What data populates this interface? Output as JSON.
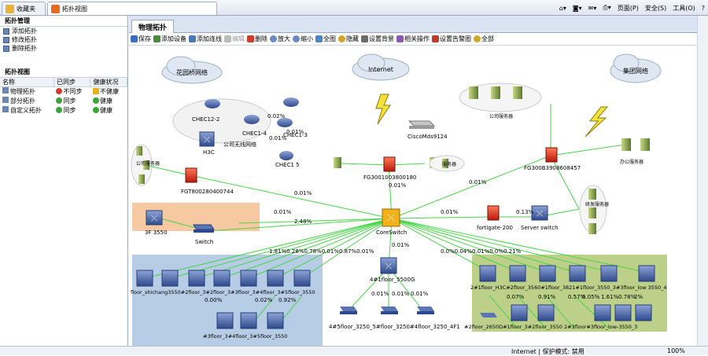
{
  "browser": {
    "tabs": [
      {
        "label": "收藏夹"
      },
      {
        "label": "拓扑视图"
      }
    ],
    "tools": {
      "page": "页面(P)",
      "safety": "安全(S)",
      "tools": "工具(O)",
      "help": "?"
    }
  },
  "left": {
    "manage_title": "拓扑管理",
    "manage_items": [
      {
        "label": "添加拓扑"
      },
      {
        "label": "修改拓扑"
      },
      {
        "label": "删除拓扑"
      }
    ],
    "view_title": "拓扑视图",
    "table_headers": [
      "名称",
      "已同步",
      "健康状况"
    ],
    "rows": [
      {
        "name": "物理拓扑",
        "sync": "不同步",
        "health": "不健康"
      },
      {
        "name": "部分拓扑",
        "sync": "同步",
        "health": "健康"
      },
      {
        "name": "自定义拓扑",
        "sync": "同步",
        "health": "健康"
      }
    ]
  },
  "main": {
    "tab": "物理拓扑",
    "toolbar": [
      "保存",
      "添加设备",
      "添加连线",
      "编辑",
      "删除",
      "放大",
      "缩小",
      "全图",
      "隐藏",
      "设置背景",
      "相关操作",
      "设置告警图",
      "全部"
    ]
  },
  "topology": {
    "clouds": {
      "garden": "花园桥网络",
      "internet": "Internet",
      "group": "集团网络"
    },
    "labels": {
      "core": "CoreSwitch",
      "company_servers": "公司服务器",
      "office_servers": "办公服务器",
      "fgt_left": "FGT800280400744",
      "fgt_mid": "FG3001003800180",
      "fgt_right": "FG300B3908608457",
      "cisco": "CiscoMds9124",
      "s3550": "3F 3550",
      "switch": "Switch",
      "fortigate": "fortigate-200",
      "server_switch": "Server switch",
      "wireless": "公司无线网络",
      "h3c": "H3C",
      "chec12": "CHEC12-2",
      "chec14": "CHEC1-4",
      "chec13": "CHEC1-3",
      "chec15": "CHEC1 5",
      "pct1": "0.02%",
      "pct2": "0.01%",
      "pct3": "0.01%",
      "s5500": "4#1floor_5500G",
      "mid_srv": "服务器",
      "left_srv": "公司服务器",
      "right_srv": "研发服务器"
    },
    "link_pcts": {
      "p001a": "0.01%",
      "p001b": "0.01%",
      "p001c": "0.01%",
      "p001d": "0.01%",
      "p001e": "0.01%",
      "p248": "2.48%",
      "p013": "0.13%",
      "p001f": "0.01%",
      "p001g": "0.01%",
      "left_group": "1.81%0.28%0.78%0.01%0.87%0.01%",
      "right_group": "0.0%0.04%0.01%0.0%0.21%",
      "low1": "0.01%",
      "low2": "0.01%",
      "low3": "0.01%",
      "lp1": "0.00%",
      "lp2": "0.02%",
      "lp3": "0.92%",
      "rp1": "0.07%",
      "rp2": "0.91%",
      "rp3": "0.57%",
      "rp4": "0.05%",
      "rp5": "1.61%",
      "rp6": "0.78%",
      "rp7": "2%"
    },
    "left_group": {
      "row1": "floor_shichang3550#2floor_3#2floor_3#3floor_3#4floor_3#5floor_3550",
      "row2": "#3floor_3#4floor_3#5floor_3550"
    },
    "bottom_group": {
      "row1": "4#5floor_3250_5#floor_3250#4floor_3250_4F1"
    },
    "right_group": {
      "row1": "2#1floor_H3C#2floor_3560#1floor_3821#1floor_3550_3#3floor_low 3550_4",
      "row2": "#2floor_2650D#1floor_3#2floor_3550 2#3floor#3floor_low-3550_3"
    }
  },
  "status": {
    "zone": "Internet | 保护模式: 禁用",
    "zoom": "100%"
  }
}
